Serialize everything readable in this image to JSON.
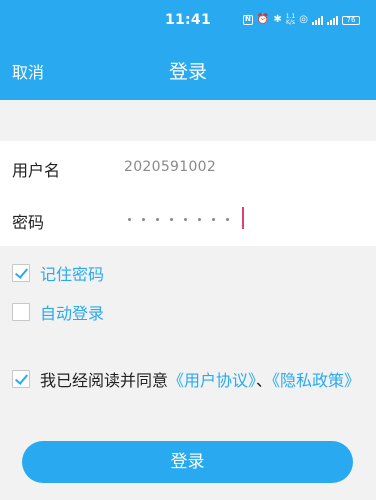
{
  "status_bar": {
    "time": "11:41",
    "nfc_icon": "nfc-icon",
    "net_speed_value": "1.1",
    "net_speed_unit": "K/s",
    "battery": "76"
  },
  "nav": {
    "cancel_label": "取消",
    "title": "登录"
  },
  "form": {
    "username_label": "用户名",
    "username_value": "2020591002",
    "password_label": "密码",
    "password_length": 8
  },
  "options": {
    "remember_label": "记住密码",
    "remember_checked": true,
    "auto_login_label": "自动登录",
    "auto_login_checked": false
  },
  "agreement": {
    "checked": true,
    "prefix": "我已经阅读并同意",
    "user_agreement_link": "《用户协议》",
    "separator": "、",
    "privacy_link": "《隐私政策》"
  },
  "login_button_label": "登录",
  "colors": {
    "accent": "#29aaf0",
    "caret": "#e0407a",
    "background": "#f2f2f2"
  }
}
